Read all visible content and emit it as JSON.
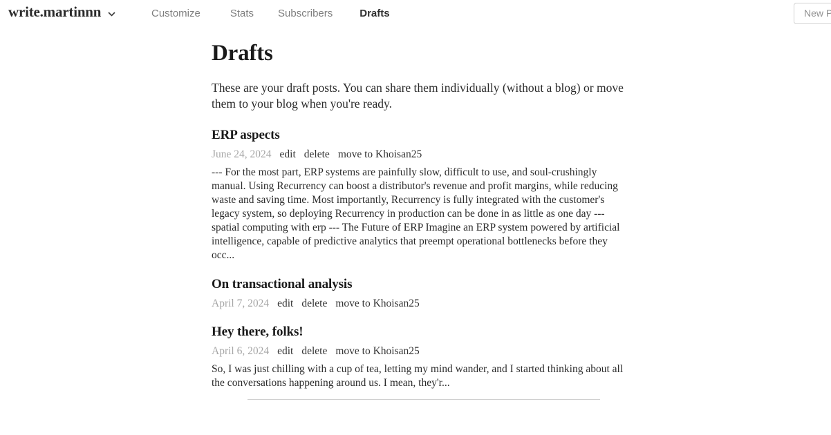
{
  "header": {
    "brand": "write.martinnn",
    "brand_chevron_icon": "chevron-down-icon",
    "nav": [
      {
        "label": "Customize",
        "active": false
      },
      {
        "label": "Stats",
        "active": false
      },
      {
        "label": "Subscribers",
        "active": false
      },
      {
        "label": "Drafts",
        "active": true
      }
    ],
    "new_post_label": "New Post"
  },
  "main": {
    "title": "Drafts",
    "intro": "These are your draft posts. You can share them individually (without a blog) or move them to your blog when you're ready.",
    "drafts": [
      {
        "title": "ERP aspects",
        "date": "June 24, 2024",
        "edit_label": "edit",
        "delete_label": "delete",
        "move_label": "move to Khoisan25",
        "excerpt": "--- For the most part, ERP systems are painfully slow, difficult to use, and soul-crushingly manual. Using Recurrency can boost a distributor's revenue and profit margins, while reducing waste and saving time. Most importantly, Recurrency is fully integrated with the customer's legacy system, so deploying Recurrency in production can be done in as little as one day --- spatial computing with erp --- The Future of ERP Imagine an ERP system powered by artificial intelligence, capable of predictive analytics that preempt operational bottlenecks before they occ..."
      },
      {
        "title": "On transactional analysis",
        "date": "April 7, 2024",
        "edit_label": "edit",
        "delete_label": "delete",
        "move_label": "move to Khoisan25",
        "excerpt": ""
      },
      {
        "title": "Hey there, folks!",
        "date": "April 6, 2024",
        "edit_label": "edit",
        "delete_label": "delete",
        "move_label": "move to Khoisan25",
        "excerpt": "So, I was just chilling with a cup of tea, letting my mind wander, and I started thinking about all the conversations happening around us. I mean, they'r..."
      }
    ]
  },
  "colors": {
    "background": "#ffffff",
    "text": "#222222",
    "muted": "#a6a6a6",
    "nav_inactive": "#7d7d7d",
    "nav_active": "#2f2f2f",
    "divider": "#cfcfcf",
    "button_border": "#d2d2d2"
  }
}
